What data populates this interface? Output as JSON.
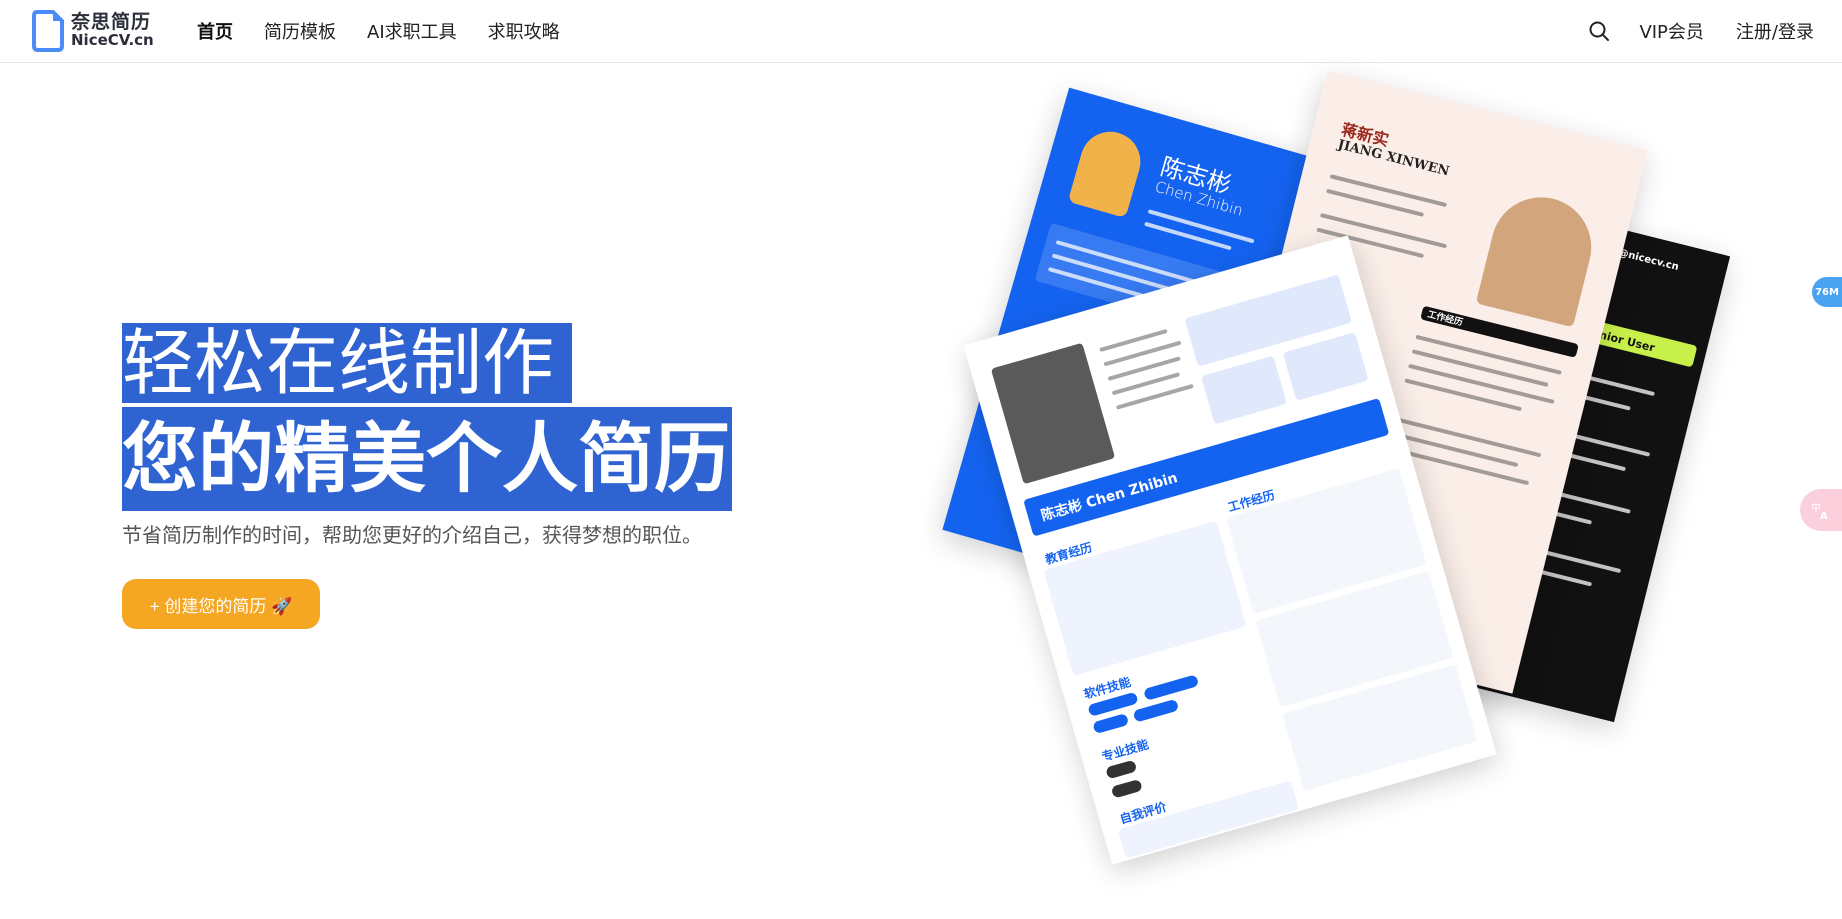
{
  "header": {
    "logo_cn": "奈思简历",
    "logo_en": "NiceCV.cn",
    "nav": [
      {
        "label": "首页",
        "active": true
      },
      {
        "label": "简历模板",
        "active": false
      },
      {
        "label": "AI求职工具",
        "active": false
      },
      {
        "label": "求职攻略",
        "active": false
      }
    ],
    "search_icon": "search-icon",
    "vip_label": "VIP会员",
    "login_label": "注册/登录"
  },
  "hero": {
    "title_line1": "轻松在线制作",
    "title_line2": "您的精美个人简历",
    "subtitle": "节省简历制作的时间，帮助您更好的介绍自己，获得梦想的职位。",
    "cta_label": "+ 创建您的简历 🚀",
    "highlight_color": "#2f63d2",
    "cta_color": "#f5a623"
  },
  "widgets": {
    "perf_badge": "76M",
    "translate_icon": "translate-icon"
  },
  "collage": {
    "blue_name_cn": "陈志彬",
    "blue_name_en": "Chen Zhibin",
    "pink_name_cn": "蒋新实",
    "pink_name_en": "JIANG XINWEN",
    "pink_section": "工作经历",
    "main_name": "陈志彬 Chen Zhibin",
    "main_sections": [
      "教育经历",
      "工作经历",
      "软件技能",
      "专业技能",
      "自我评价"
    ],
    "black_title": "设计师 Senior User",
    "black_email": "chenzhibin@nicecv.cn"
  }
}
